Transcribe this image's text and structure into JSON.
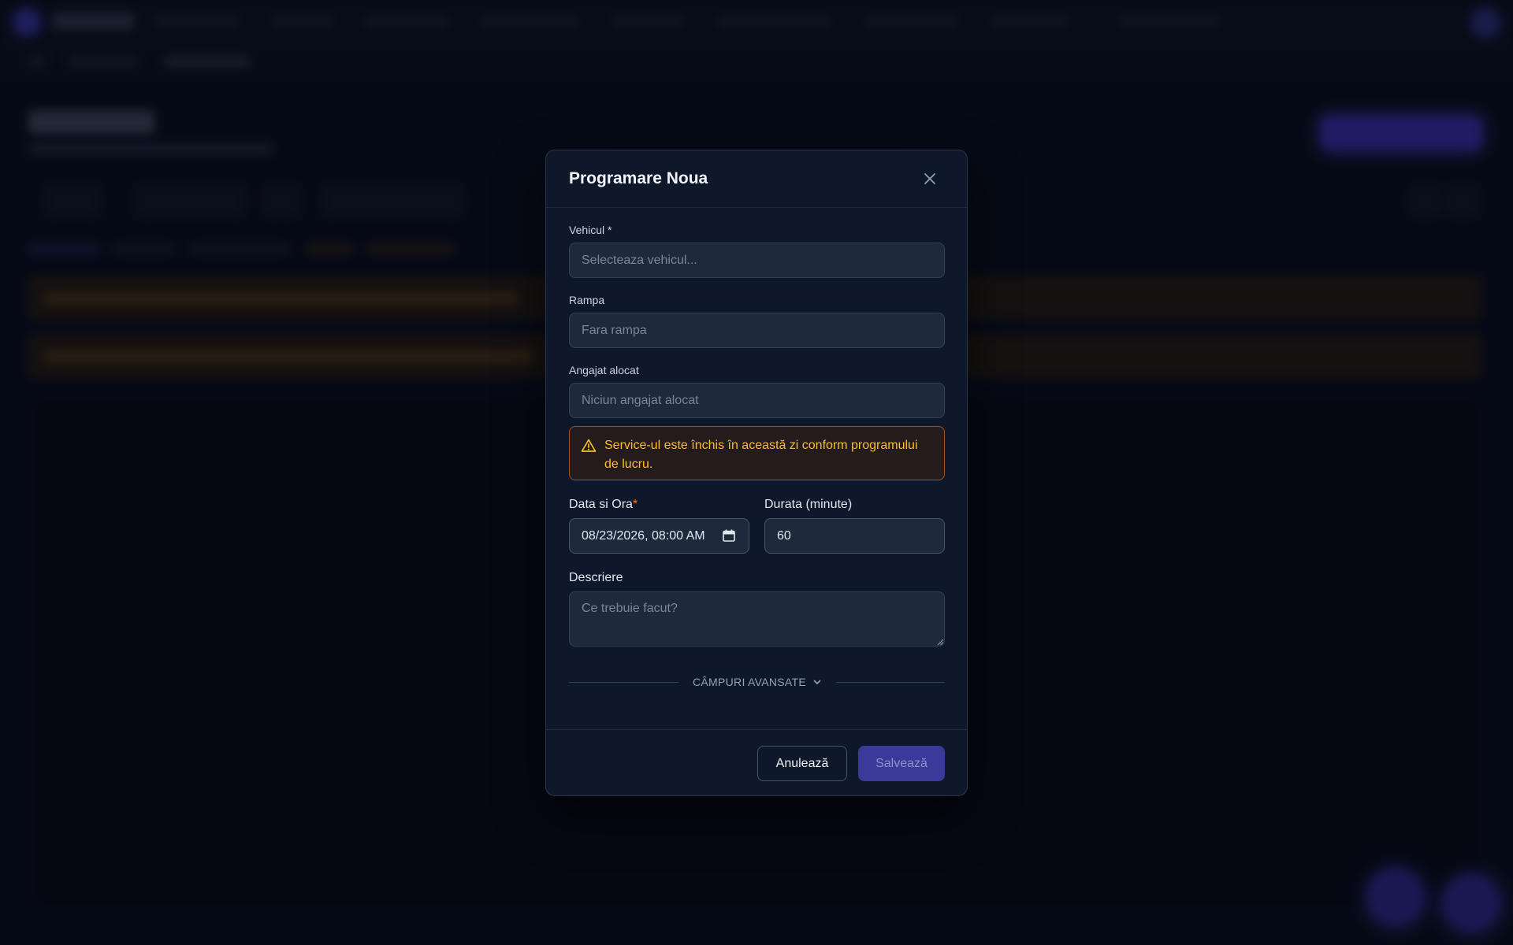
{
  "modal": {
    "title": "Programare Noua",
    "vehicle": {
      "label": "Vehicul *",
      "placeholder": "Selecteaza vehicul..."
    },
    "ramp": {
      "label": "Rampa",
      "placeholder": "Fara rampa"
    },
    "employee": {
      "label": "Angajat alocat",
      "placeholder": "Niciun angajat alocat"
    },
    "alert": {
      "text": "Service-ul este închis în această zi conform programului de lucru.",
      "icon": "warning-triangle-icon"
    },
    "datetime": {
      "label": "Data si Ora",
      "required_mark": "*",
      "value": "08/23/2026, 08:00 AM"
    },
    "duration": {
      "label": "Durata (minute)",
      "value": "60"
    },
    "description": {
      "label": "Descriere",
      "placeholder": "Ce trebuie facut?"
    },
    "advanced_toggle": "CÂMPURI AVANSATE",
    "cancel_label": "Anulează",
    "save_label": "Salvează"
  },
  "colors": {
    "accent": "#4f46e5",
    "warning": "#fbbf24",
    "modal_bg": "#0f172a"
  }
}
